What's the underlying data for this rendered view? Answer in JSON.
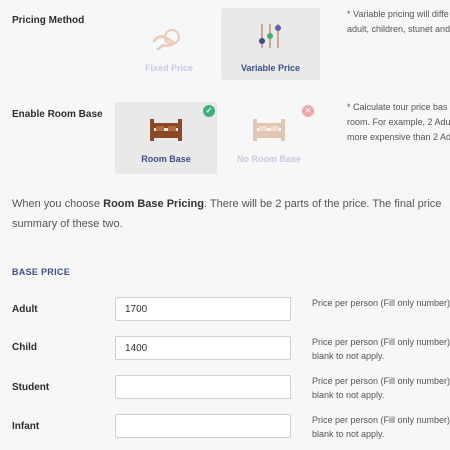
{
  "pricing_method": {
    "label": "Pricing Method",
    "options": [
      {
        "label": "Fixed Price",
        "selected": false,
        "icon": "hand-money-icon"
      },
      {
        "label": "Variable Price",
        "selected": true,
        "icon": "sliders-icon"
      }
    ],
    "note_line1": "* Variable pricing will diffe",
    "note_line2": "adult, children, stunet and"
  },
  "room_base": {
    "label": "Enable Room Base",
    "options": [
      {
        "label": "Room Base",
        "selected": true,
        "icon": "bed-icon",
        "badge": "check"
      },
      {
        "label": "No Room Base",
        "selected": false,
        "icon": "bed-icon",
        "badge": "close"
      }
    ],
    "note_line1": "* Calculate tour price bas",
    "note_line2": "room. For example, 2 Adu",
    "note_line3": "more expensive than 2 Ad"
  },
  "info": {
    "line1_pre": "When you choose ",
    "line1_bold": "Room Base Pricing",
    "line1_post": ". There will be 2 parts of the price. The final price",
    "line2": "summary of these two."
  },
  "base_price": {
    "heading": "BASE PRICE",
    "rows": [
      {
        "label": "Adult",
        "value": "1700",
        "help1": "Price per person (Fill only number)",
        "help2": ""
      },
      {
        "label": "Child",
        "value": "1400",
        "help1": "Price per person (Fill only number)",
        "help2": "blank to not apply."
      },
      {
        "label": "Student",
        "value": "",
        "help1": "Price per person (Fill only number)",
        "help2": "blank to not apply."
      },
      {
        "label": "Infant",
        "value": "",
        "help1": "Price per person (Fill only number)",
        "help2": "blank to not apply."
      }
    ]
  },
  "colors": {
    "accent": "#3c4f8a",
    "check": "#3fb07a",
    "close": "#f2a8a8",
    "bed_active": "#8b4a25",
    "bed_inactive": "#e3c6b3"
  }
}
